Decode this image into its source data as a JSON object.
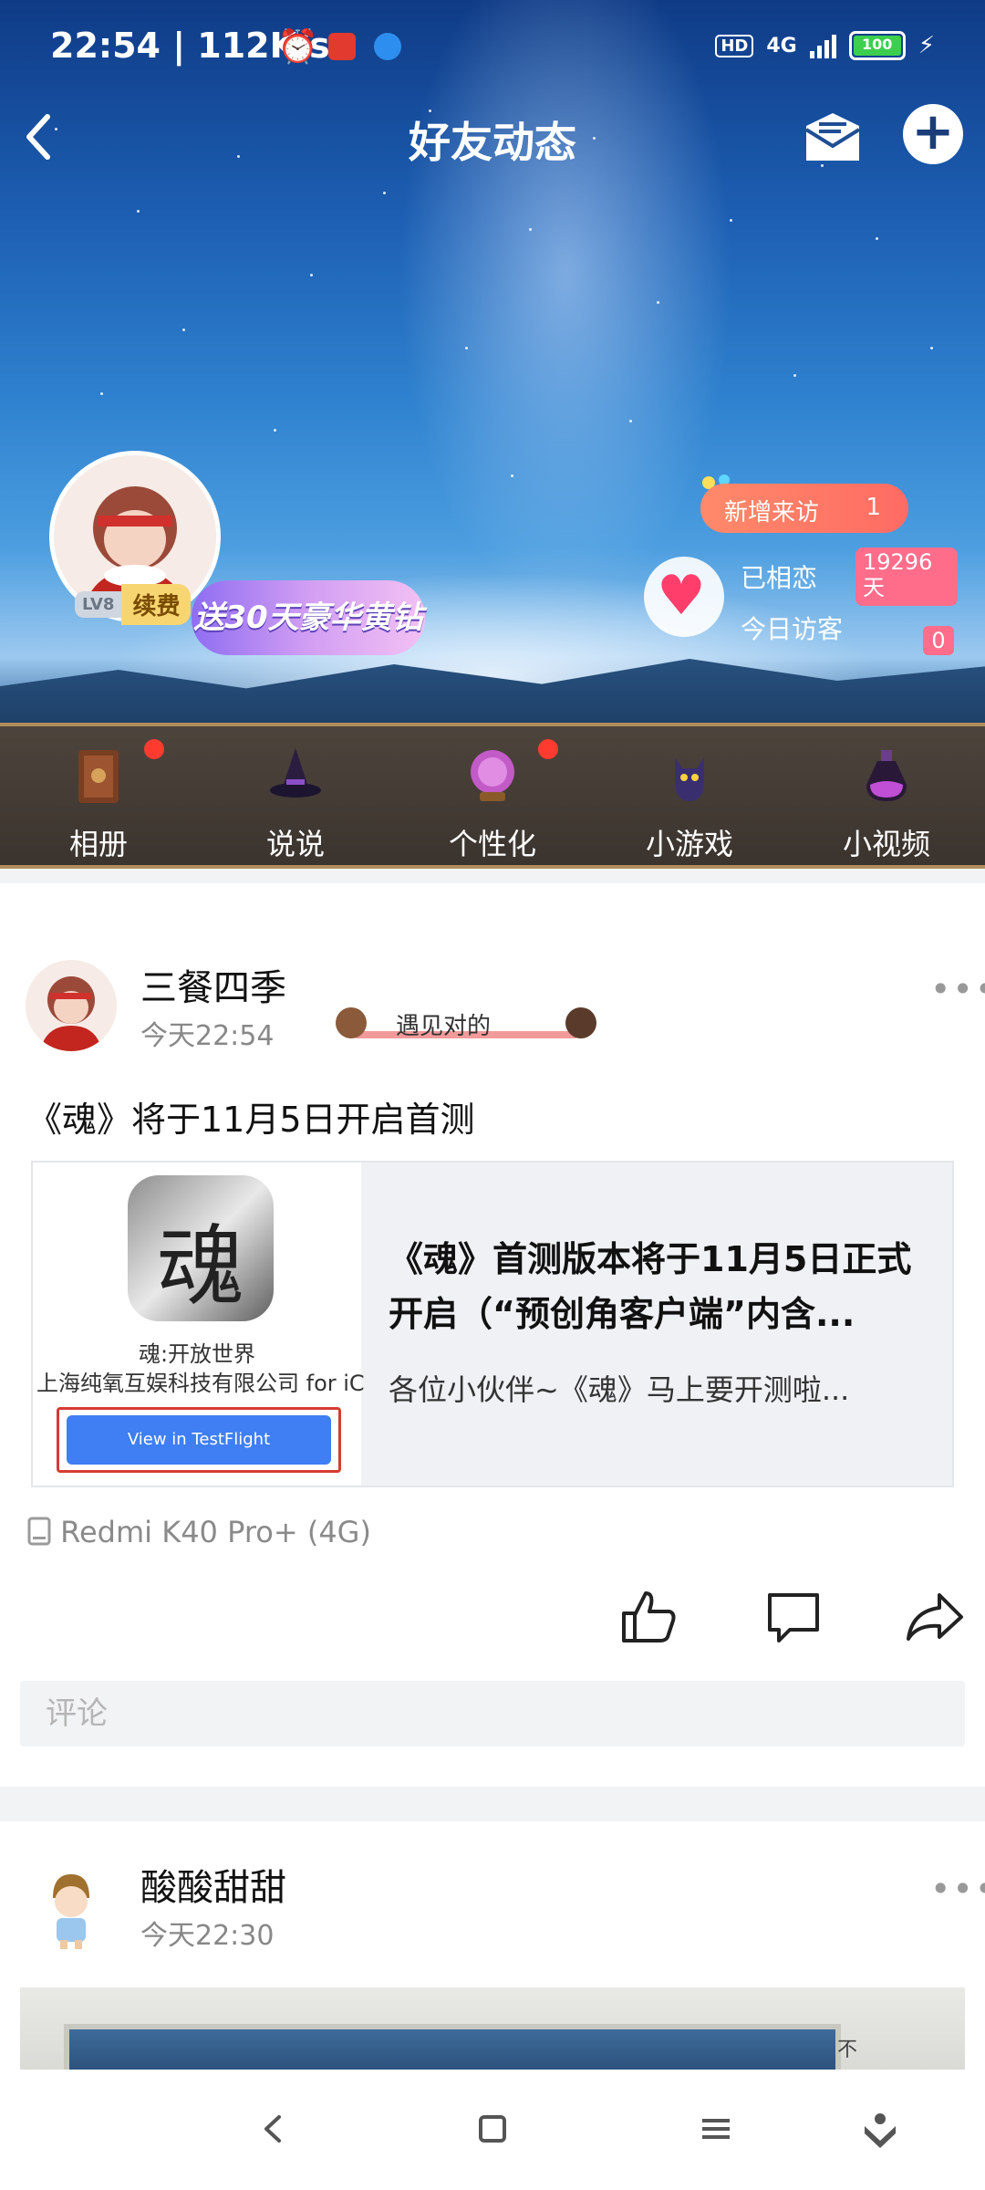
{
  "status_bar": {
    "time": "22:54 | 112K/s",
    "hd": "HD",
    "network": "4G",
    "battery": "100"
  },
  "header": {
    "title": "好友动态"
  },
  "profile": {
    "level": "LV8",
    "renew_label": "续费",
    "promo": "送30天豪华黄钻",
    "new_visits_label": "新增来访",
    "new_visits_count": "1",
    "love_label": "已相恋",
    "love_days": "19296天",
    "today_visitors_label": "今日访客",
    "today_visitors_count": "0"
  },
  "menu": {
    "items": [
      {
        "label": "相册",
        "icon": "album-book-icon",
        "dot": true
      },
      {
        "label": "说说",
        "icon": "witch-hat-icon",
        "dot": false
      },
      {
        "label": "个性化",
        "icon": "crystal-ball-icon",
        "dot": true
      },
      {
        "label": "小游戏",
        "icon": "black-cat-icon",
        "dot": false
      },
      {
        "label": "小视频",
        "icon": "potion-icon",
        "dot": false
      }
    ]
  },
  "post1": {
    "author": "三餐四季",
    "time": "今天22:54",
    "sticker": "遇见对的",
    "text": "《魂》将于11月5日开启首测",
    "card": {
      "app_glyph": "魂",
      "app_name": "魂:开放世界",
      "developer": "上海纯氧互娱科技有限公司 for iC",
      "button": "View in TestFlight",
      "title": "《魂》首测版本将于11月5日正式开启（“预创角客户端”内含...",
      "description": "各位小伙伴~《魂》马上要开测啦..."
    },
    "device": "Redmi K40 Pro+ (4G)",
    "comment_placeholder": "评论"
  },
  "post2": {
    "author": "酸酸甜甜",
    "time": "今天22:30",
    "photo_side_text": "不"
  }
}
